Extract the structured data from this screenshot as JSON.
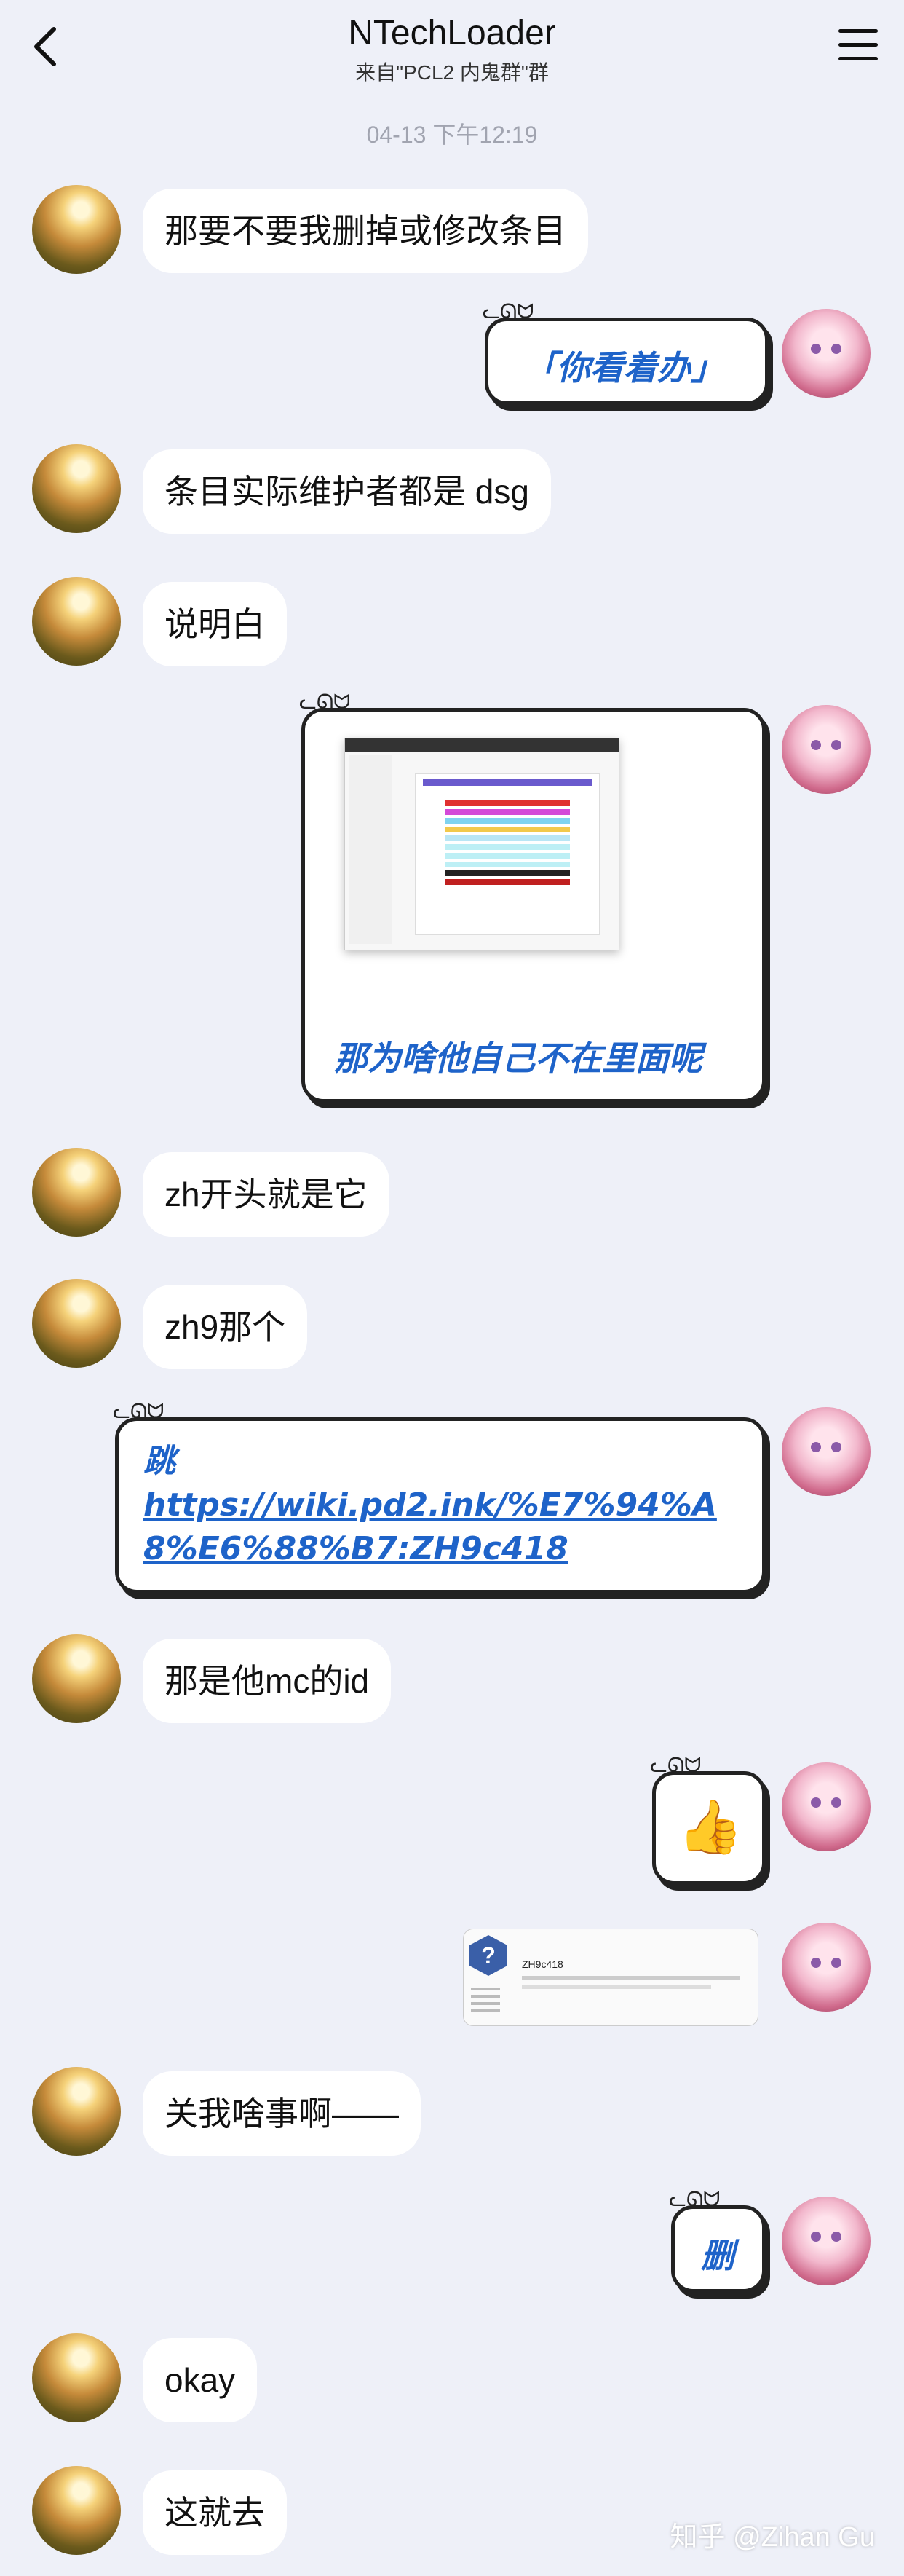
{
  "header": {
    "title": "NTechLoader",
    "subtitle": "来自\"PCL2 内鬼群\"群"
  },
  "timestamp": "04-13 下午12:19",
  "messages": {
    "m1": "那要不要我删掉或修改条目",
    "m2": "「你看着办」",
    "m3": "条目实际维护者都是 dsg",
    "m4": "说明白",
    "m5": "那为啥他自己不在里面呢",
    "m6": "zh开头就是它",
    "m7": "zh9那个",
    "m8_prefix": "跳",
    "m8_link": "https://wiki.pd2.ink/%E7%94%A8%E6%88%B7:ZH9c418",
    "m9": "那是他mc的id",
    "m10_emoji": "👍",
    "m11_page_title": "ZH9c418",
    "m12": "关我啥事啊——",
    "m13": "删",
    "m14": "okay",
    "m15": "这就去"
  },
  "watermark": "知乎 @Zihan Gu",
  "icons": {
    "back": "chevron-left-icon",
    "menu": "hamburger-menu-icon",
    "help": "question-icon"
  },
  "colors": {
    "background": "#eef0f8",
    "bubble": "#ffffff",
    "accent_text": "#1e63c9"
  }
}
